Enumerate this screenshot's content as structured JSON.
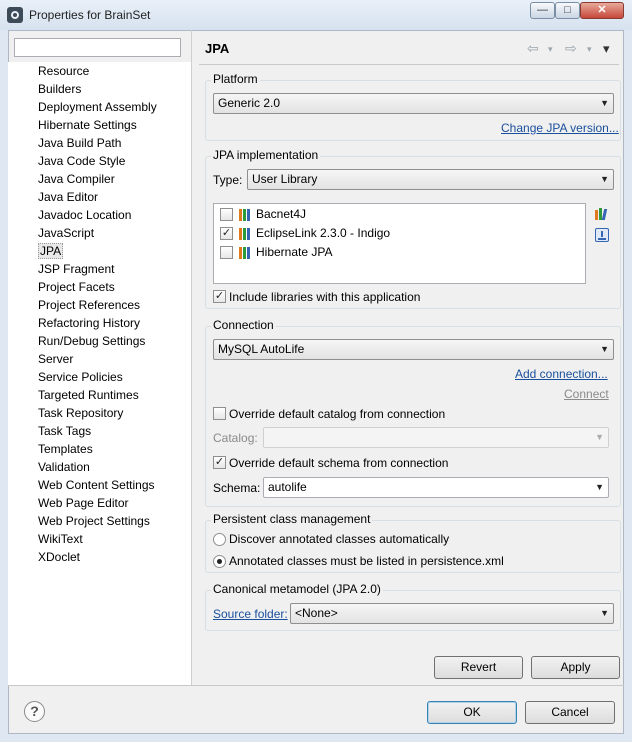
{
  "window": {
    "title": "Properties for BrainSet",
    "min_glyph": "—",
    "max_glyph": "□",
    "close_glyph": "✕"
  },
  "nav": {
    "filter_value": "",
    "items": [
      "Resource",
      "Builders",
      "Deployment Assembly",
      "Hibernate Settings",
      "Java Build Path",
      "Java Code Style",
      "Java Compiler",
      "Java Editor",
      "Javadoc Location",
      "JavaScript",
      "JPA",
      "JSP Fragment",
      "Project Facets",
      "Project References",
      "Refactoring History",
      "Run/Debug Settings",
      "Server",
      "Service Policies",
      "Targeted Runtimes",
      "Task Repository",
      "Task Tags",
      "Templates",
      "Validation",
      "Web Content Settings",
      "Web Page Editor",
      "Web Project Settings",
      "WikiText",
      "XDoclet"
    ],
    "selected": "JPA"
  },
  "page": {
    "title": "JPA",
    "back_glyph": "⇦",
    "forward_glyph": "⇨",
    "dropdown_glyph": "▾"
  },
  "platform": {
    "label": "Platform",
    "value": "Generic 2.0",
    "change_link": "Change JPA version..."
  },
  "implementation": {
    "label": "JPA implementation",
    "type_label": "Type:",
    "type_value": "User Library",
    "libraries": [
      {
        "name": "Bacnet4J",
        "checked": false
      },
      {
        "name": "EclipseLink 2.3.0 - Indigo",
        "checked": true
      },
      {
        "name": "Hibernate JPA",
        "checked": false
      }
    ],
    "include_label": "Include libraries with this application",
    "include_checked": true
  },
  "connection": {
    "label": "Connection",
    "value": "MySQL AutoLife",
    "add_link": "Add connection...",
    "connect_link": "Connect",
    "override_catalog_label": "Override default catalog from connection",
    "override_catalog_checked": false,
    "catalog_label": "Catalog:",
    "catalog_value": "",
    "override_schema_label": "Override default schema from connection",
    "override_schema_checked": true,
    "schema_label": "Schema:",
    "schema_value": "autolife"
  },
  "persistent": {
    "label": "Persistent class management",
    "option_discover": "Discover annotated classes automatically",
    "option_listed": "Annotated classes must be listed in persistence.xml",
    "selected": "listed"
  },
  "canonical": {
    "label": "Canonical metamodel (JPA 2.0)",
    "source_folder_link": "Source folder:",
    "source_folder_value": "<None>"
  },
  "buttons": {
    "revert": "Revert",
    "apply": "Apply",
    "ok": "OK",
    "cancel": "Cancel",
    "help": "?"
  },
  "check_glyph": "✓",
  "colors": {
    "link": "#1a4f9c",
    "library_icon_bars": [
      "#e07a1f",
      "#2f9a3a",
      "#3466b4"
    ]
  }
}
